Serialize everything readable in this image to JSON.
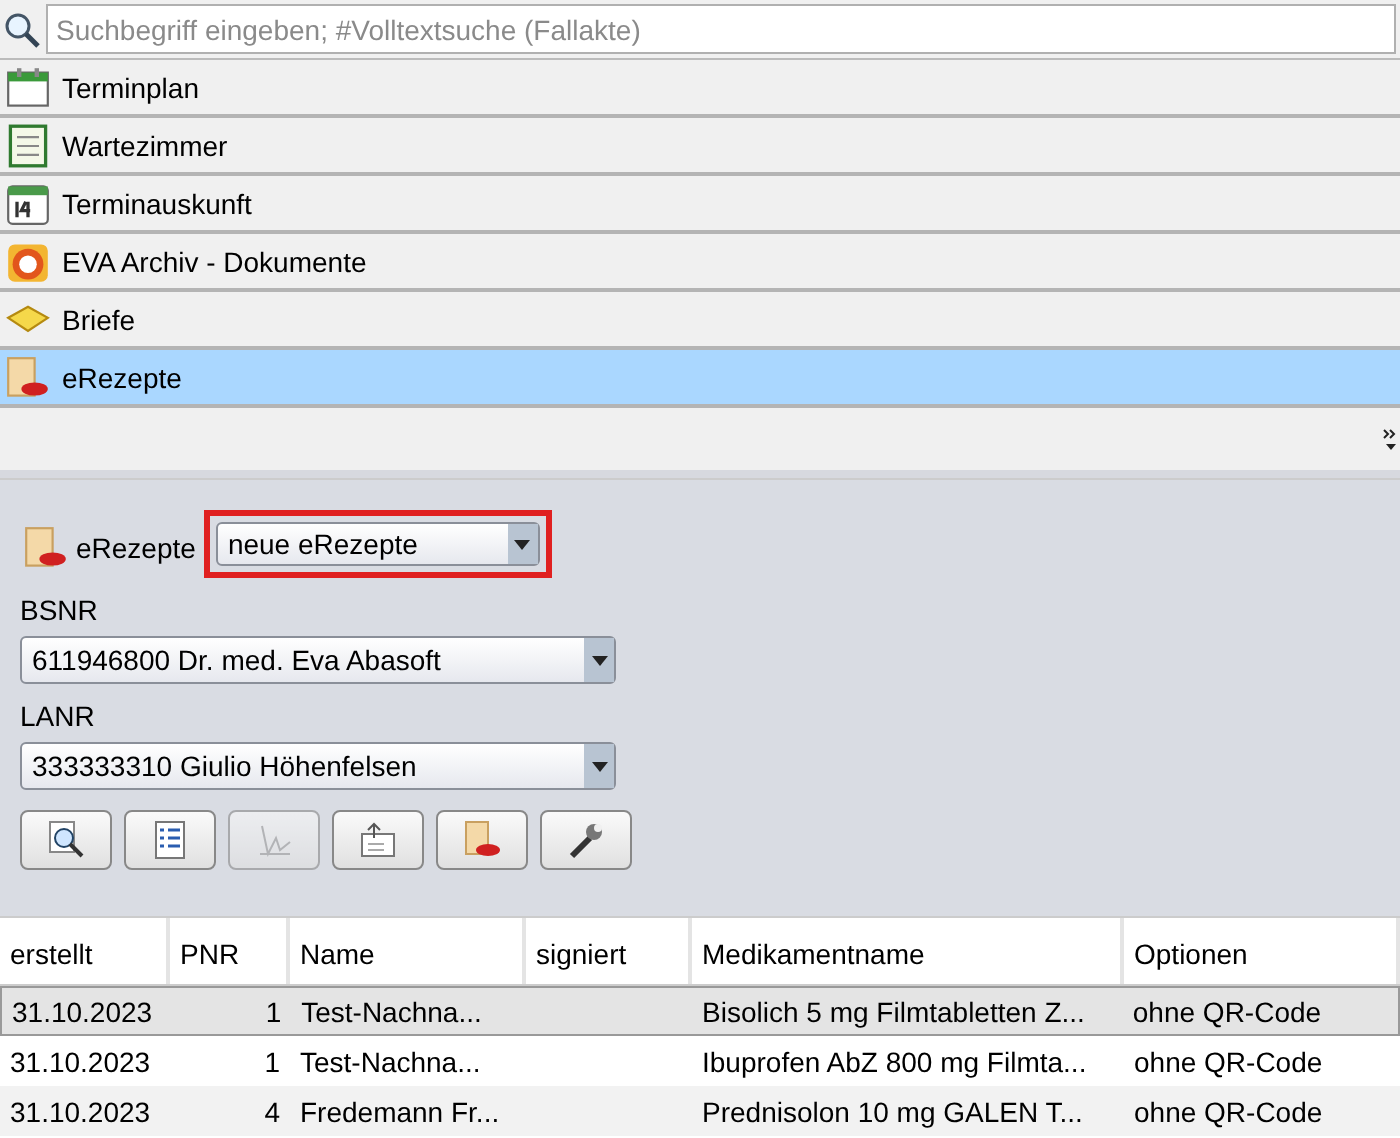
{
  "search": {
    "placeholder": "Suchbegriff eingeben; #Volltextsuche (Fallakte)"
  },
  "nav_items": [
    {
      "label": "Terminplan",
      "kind": "calendar",
      "selected": false
    },
    {
      "label": "Wartezimmer",
      "kind": "list",
      "selected": false
    },
    {
      "label": "Terminauskunft",
      "kind": "date",
      "selected": false
    },
    {
      "label": "EVA Archiv - Dokumente",
      "kind": "archive",
      "selected": false
    },
    {
      "label": "Briefe",
      "kind": "letter",
      "selected": false
    },
    {
      "label": "eRezepte",
      "kind": "prescription",
      "selected": true
    }
  ],
  "panel": {
    "title": "eRezepte",
    "filter": {
      "value": "neue eRezepte",
      "highlighted": true
    },
    "bsnr": {
      "label": "BSNR",
      "value": "611946800 Dr. med. Eva Abasoft"
    },
    "lanr": {
      "label": "LANR",
      "value": "333333310 Giulio Höhenfelsen"
    },
    "tools": [
      {
        "kind": "search",
        "disabled": false
      },
      {
        "kind": "list",
        "disabled": false
      },
      {
        "kind": "sign",
        "disabled": true
      },
      {
        "kind": "send",
        "disabled": false
      },
      {
        "kind": "prescription",
        "disabled": false
      },
      {
        "kind": "wrench",
        "disabled": false
      }
    ]
  },
  "table": {
    "columns": [
      "erstellt",
      "PNR",
      "Name",
      "signiert",
      "Medikamentname",
      "Optionen"
    ],
    "rows": [
      {
        "selected": true,
        "cells": [
          "31.10.2023",
          "1",
          "Test-Nachna...",
          "",
          "Bisolich 5 mg Filmtabletten Z...",
          "ohne QR-Code"
        ]
      },
      {
        "selected": false,
        "cells": [
          "31.10.2023",
          "1",
          "Test-Nachna...",
          "",
          "Ibuprofen AbZ 800 mg Filmta...",
          "ohne QR-Code"
        ]
      },
      {
        "selected": false,
        "cells": [
          "31.10.2023",
          "4",
          "Fredemann Fr...",
          "",
          "Prednisolon 10 mg GALEN T...",
          "ohne QR-Code"
        ]
      }
    ]
  }
}
